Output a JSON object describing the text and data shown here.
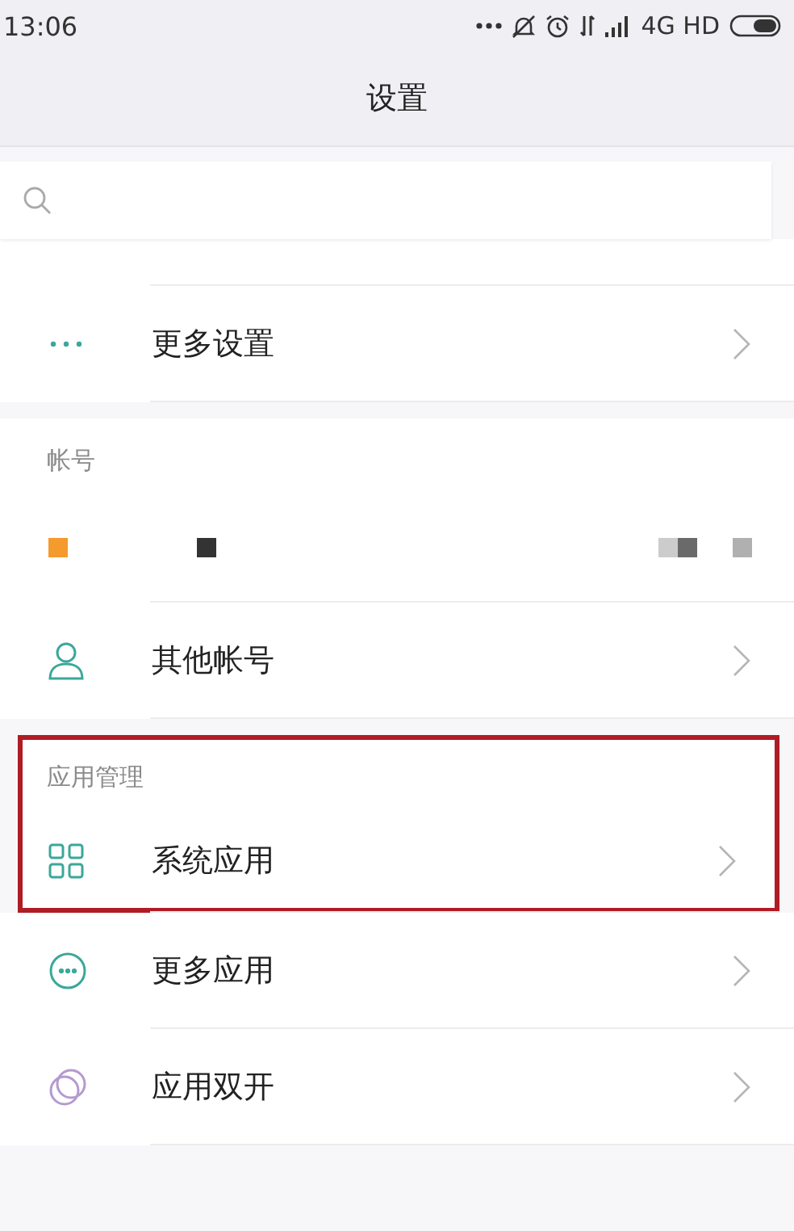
{
  "status_bar": {
    "time": "13:06",
    "network": "4G HD"
  },
  "title": "设置",
  "sections": [
    {
      "items": [
        {
          "kind": "partial"
        },
        {
          "kind": "nav",
          "label": "更多设置"
        }
      ]
    },
    {
      "header": "帐号",
      "items": [
        {
          "kind": "account"
        },
        {
          "kind": "nav",
          "label": "其他帐号"
        }
      ]
    },
    {
      "highlighted": true,
      "header": "应用管理",
      "items": [
        {
          "kind": "nav",
          "label": "系统应用"
        }
      ]
    },
    {
      "items": [
        {
          "kind": "nav",
          "label": "更多应用"
        },
        {
          "kind": "nav",
          "label": "应用双开"
        }
      ]
    }
  ]
}
